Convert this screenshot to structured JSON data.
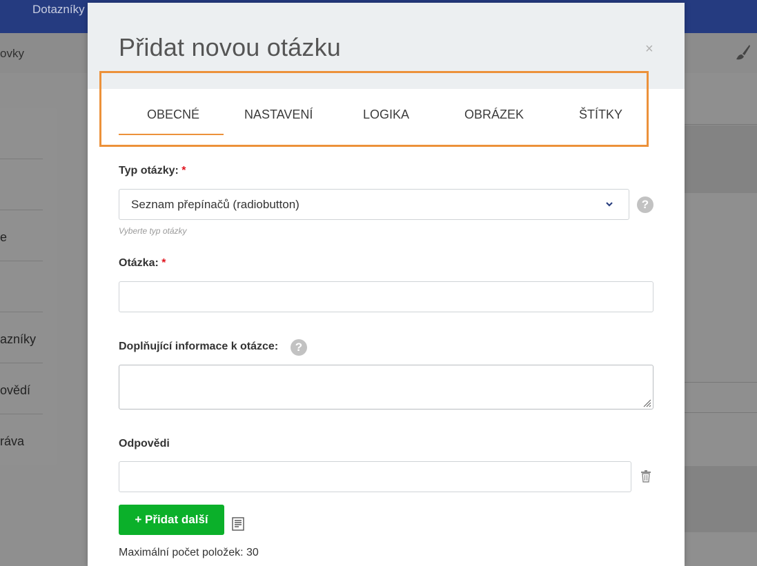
{
  "background": {
    "app_title": "Dotazníky",
    "breadcrumb_fragment": "ovky",
    "left_menu": [
      "e",
      "azníky",
      "ovědí",
      "ráva"
    ]
  },
  "modal": {
    "title": "Přidat novou otázku",
    "close_glyph": "×",
    "tabs": [
      "OBECNÉ",
      "NASTAVENÍ",
      "LOGIKA",
      "OBRÁZEK",
      "ŠTÍTKY"
    ],
    "active_tab": "OBECNÉ",
    "accent_color": "#ec913a",
    "highlight_color": "#ec913a"
  },
  "form": {
    "type": {
      "label": "Typ otázky:",
      "required_mark": "*",
      "selected": "Seznam přepínačů (radiobutton)",
      "hint": "Vyberte typ otázky",
      "help_glyph": "?"
    },
    "question": {
      "label": "Otázka:",
      "required_mark": "*",
      "value": ""
    },
    "extra_info": {
      "label": "Doplňující informace k otázce:",
      "help_glyph": "?",
      "value": ""
    },
    "answers": {
      "label": "Odpovědi",
      "value": "",
      "add_button": "+ Přidat další",
      "add_button_color": "#0bb02a",
      "max_items": "Maximální počet položek: 30"
    }
  }
}
